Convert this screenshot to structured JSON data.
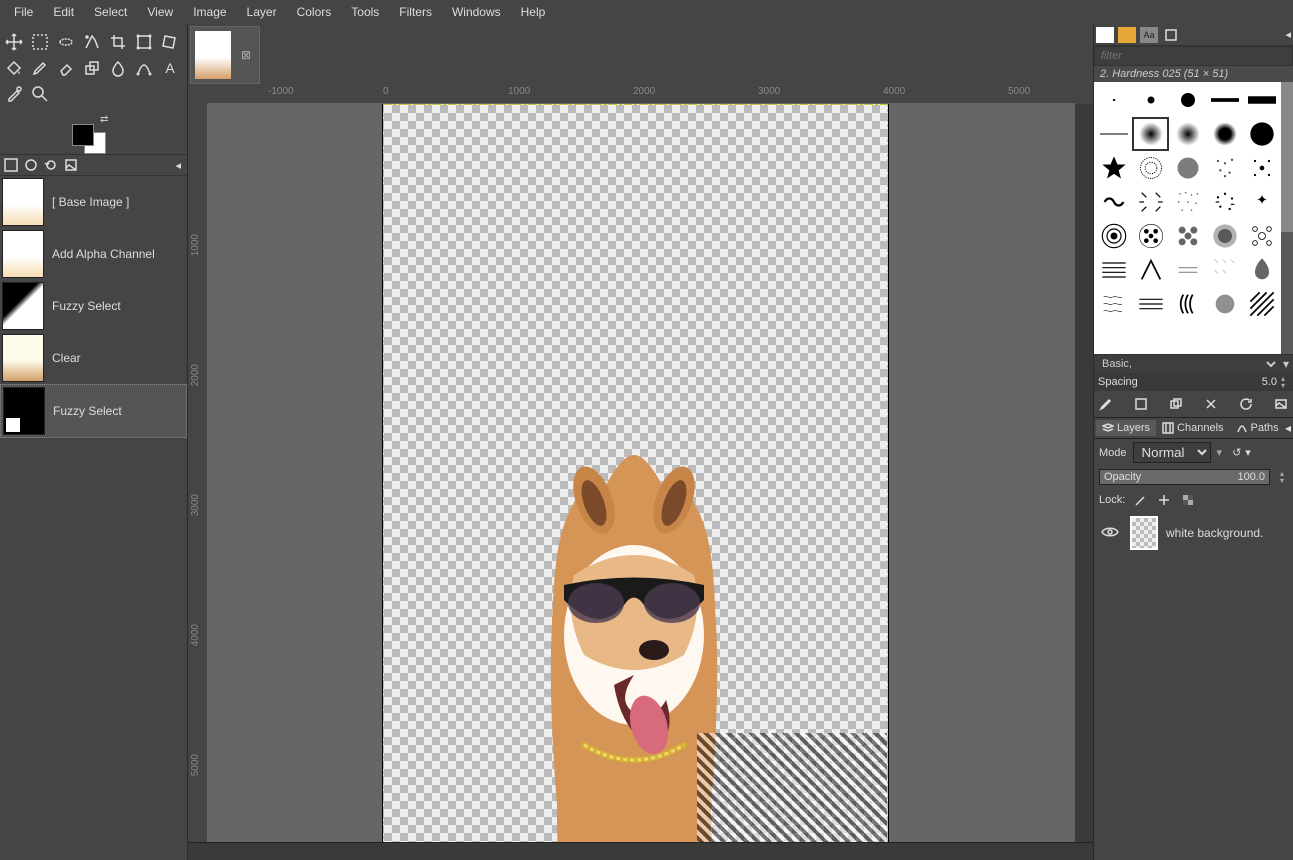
{
  "menubar": [
    "File",
    "Edit",
    "Select",
    "View",
    "Image",
    "Layer",
    "Colors",
    "Tools",
    "Filters",
    "Windows",
    "Help"
  ],
  "history": [
    {
      "label": "[ Base Image ]",
      "thumbClass": "ht-bi"
    },
    {
      "label": "Add Alpha Channel",
      "thumbClass": "ht-bi"
    },
    {
      "label": "Fuzzy Select",
      "thumbClass": "ht-fz"
    },
    {
      "label": "Clear",
      "thumbClass": "ht-cl"
    },
    {
      "label": "Fuzzy Select",
      "thumbClass": "ht-fz2"
    }
  ],
  "ruler_top": [
    {
      "pos": 60,
      "label": "-1000"
    },
    {
      "pos": 175,
      "label": "0"
    },
    {
      "pos": 300,
      "label": "1000"
    },
    {
      "pos": 425,
      "label": "2000"
    },
    {
      "pos": 550,
      "label": "3000"
    },
    {
      "pos": 675,
      "label": "4000"
    },
    {
      "pos": 800,
      "label": "5000"
    }
  ],
  "ruler_left": [
    {
      "pos": 130,
      "label": "1000"
    },
    {
      "pos": 260,
      "label": "2000"
    },
    {
      "pos": 390,
      "label": "3000"
    },
    {
      "pos": 520,
      "label": "4000"
    },
    {
      "pos": 650,
      "label": "5000"
    }
  ],
  "brush": {
    "filter_placeholder": "filter",
    "name": "2. Hardness 025 (51 × 51)",
    "preset": "Basic,",
    "spacing_label": "Spacing",
    "spacing_value": "5.0"
  },
  "lcp": {
    "tabs": [
      "Layers",
      "Channels",
      "Paths"
    ],
    "mode_label": "Mode",
    "mode_value": "Normal",
    "opacity_label": "Opacity",
    "opacity_value": "100.0",
    "lock_label": "Lock:"
  },
  "layers": [
    {
      "name": "white background."
    }
  ]
}
